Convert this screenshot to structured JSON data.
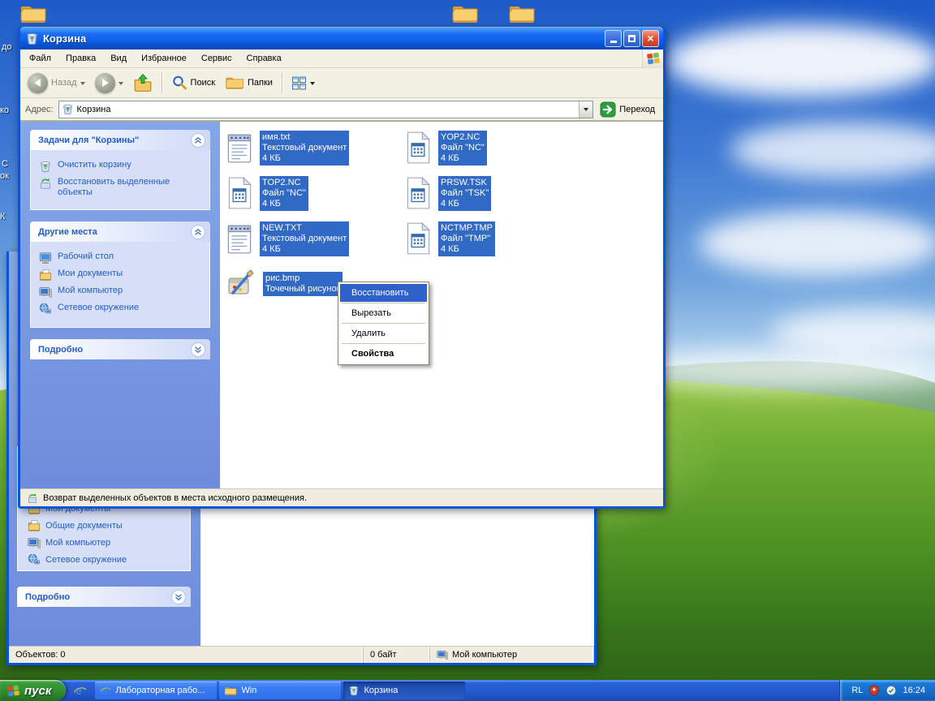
{
  "desktop": {
    "edge_labels": [
      "до",
      "ко",
      "С",
      "ок",
      "К"
    ]
  },
  "window": {
    "title": "Корзина",
    "menu": [
      "Файл",
      "Правка",
      "Вид",
      "Избранное",
      "Сервис",
      "Справка"
    ],
    "toolbar": {
      "back": "Назад",
      "search": "Поиск",
      "folders": "Папки"
    },
    "address": {
      "label": "Адрес:",
      "value": "Корзина",
      "go": "Переход"
    },
    "sidebar": {
      "tasks_title": "Задачи для \"Корзины\"",
      "tasks": [
        "Очистить корзину",
        "Восстановить выделенные объекты"
      ],
      "places_title": "Другие места",
      "places": [
        "Рабочий стол",
        "Мои документы",
        "Мой компьютер",
        "Сетевое окружение"
      ],
      "details_title": "Подробно"
    },
    "files": [
      {
        "name": "имя.txt",
        "type": "Текстовый документ",
        "size": "4 КБ"
      },
      {
        "name": "YOP2.NC",
        "type": "Файл \"NC\"",
        "size": "4 КБ"
      },
      {
        "name": "TOP2.NC",
        "type": "Файл \"NC\"",
        "size": "4 КБ"
      },
      {
        "name": "PRSW.TSK",
        "type": "Файл \"TSK\"",
        "size": "4 КБ"
      },
      {
        "name": "NEW.TXT",
        "type": "Текстовый документ",
        "size": "4 КБ"
      },
      {
        "name": "NCTMP.TMP",
        "type": "Файл \"TMP\"",
        "size": "4 КБ"
      },
      {
        "name": "рис.bmp",
        "type": "Точечный рисунок",
        "size": ""
      }
    ],
    "status": "Возврат выделенных объектов в места исходного размещения."
  },
  "context_menu": {
    "items": [
      "Восстановить",
      "Вырезать",
      "Удалить",
      "Свойства"
    ]
  },
  "bg_window": {
    "places": [
      "Мои документы",
      "Общие документы",
      "Мой компьютер",
      "Сетевое окружение"
    ],
    "details_title": "Подробно",
    "status_objects": "Объектов: 0",
    "status_size": "0 байт",
    "status_zone": "Мой компьютер"
  },
  "taskbar": {
    "start": "пуск",
    "tasks": [
      "Лабораторная рабо...",
      "Win",
      "Корзина"
    ],
    "lang": "RL",
    "time": "16:24"
  },
  "glyphs": {
    "close": "×"
  },
  "colors": {
    "selection": "#316ac5",
    "window_border": "#0855dd",
    "link": "#215dc6",
    "taskbar_green": "#2f8a2f"
  }
}
